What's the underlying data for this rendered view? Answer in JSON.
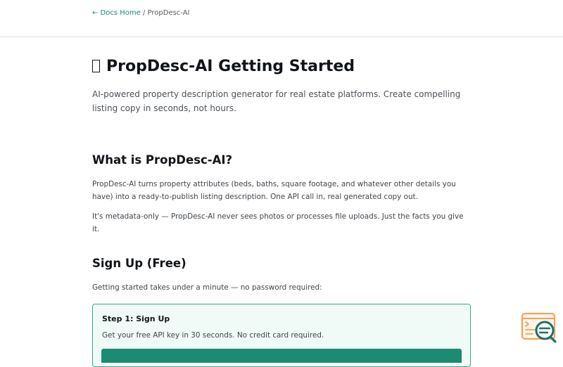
{
  "breadcrumb": {
    "back_link": "← Docs Home",
    "separator": " / ",
    "current": "PropDesc-AI"
  },
  "page": {
    "title": "PropDesc-AI Getting Started",
    "lead": "AI-powered property description generator for real estate platforms. Create compelling listing copy in seconds, not hours."
  },
  "section_what": {
    "heading": "What is PropDesc-AI?",
    "paragraph_1": "PropDesc-AI turns property attributes (beds, baths, square footage, and whatever other details you have) into a ready-to-publish listing description. One API call in, real generated copy out.",
    "paragraph_2": "It's metadata-only — PropDesc-AI never sees photos or processes file uploads. Just the facts you give it."
  },
  "section_signup": {
    "heading": "Sign Up (Free)",
    "intro": "Getting started takes under a minute — no password required:",
    "step_card": {
      "title": "Step 1: Sign Up",
      "description": "Get your free API key in 30 seconds. No credit card required."
    }
  },
  "colors": {
    "accent": "#1d8a72",
    "link": "#128a6e",
    "card_border": "#3aa78b",
    "card_background": "#f0fbf8",
    "widget_orange": "#f0a45a",
    "widget_teal": "#1f6f6a"
  },
  "icons": {
    "title_glyph": "missing-glyph-icon",
    "chat_widget": "search-chat-widget-icon"
  }
}
